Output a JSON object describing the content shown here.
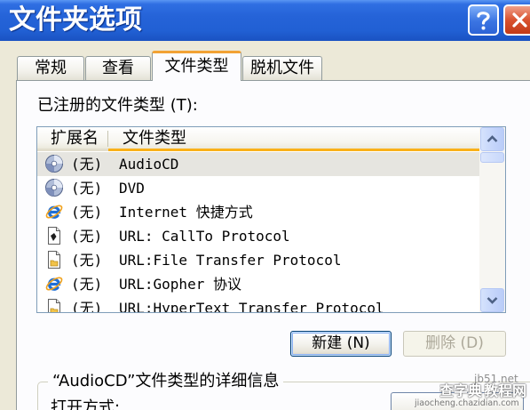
{
  "window": {
    "title": "文件夹选项",
    "help_icon": "help-icon",
    "close_icon": "close-icon"
  },
  "tabs": [
    {
      "label": "常规",
      "selected": false
    },
    {
      "label": "查看",
      "selected": false
    },
    {
      "label": "文件类型",
      "selected": true
    },
    {
      "label": "脱机文件",
      "selected": false
    }
  ],
  "file_types": {
    "label": "已注册的文件类型 (T):",
    "columns": [
      "扩展名",
      "文件类型"
    ],
    "rows": [
      {
        "extension": "(无)",
        "type": "AudioCD",
        "icon": "audio-cd-icon",
        "selected": true
      },
      {
        "extension": "(无)",
        "type": "DVD",
        "icon": "dvd-icon",
        "selected": false
      },
      {
        "extension": "(无)",
        "type": "Internet 快捷方式",
        "icon": "internet-shortcut-icon",
        "selected": false
      },
      {
        "extension": "(无)",
        "type": "URL: CallTo Protocol",
        "icon": "callto-protocol-icon",
        "selected": false
      },
      {
        "extension": "(无)",
        "type": "URL:File Transfer Protocol",
        "icon": "ftp-protocol-icon",
        "selected": false
      },
      {
        "extension": "(无)",
        "type": "URL:Gopher 协议",
        "icon": "gopher-protocol-icon",
        "selected": false
      },
      {
        "extension": "(无)",
        "type": "URL:HyperText Transfer Protocol",
        "icon": "http-protocol-icon",
        "selected": false
      }
    ],
    "scrollbar": {
      "up_icon": "chevron-up-icon",
      "down_icon": "chevron-down-icon"
    }
  },
  "actions": {
    "new_label": "新建 (N)",
    "delete_label": "删除 (D)",
    "delete_enabled": false
  },
  "details": {
    "title": "“AudioCD”文件类型的详细信息",
    "opens_with_label": "打开方式:"
  },
  "watermark": {
    "site": "jb51.net",
    "brand_left": "查字典",
    "brand_right": "教程网",
    "url": "jiaocheng.chazidian.com"
  },
  "colors": {
    "title_bar": "#2563D8",
    "dialog_background": "#ECE9D8",
    "selected_tab_accent": "#F2A234",
    "header_hover_accent": "#F9B119",
    "list_border": "#7F9DB9",
    "selected_row": "#E6E5E0",
    "disabled_text": "#ACA899"
  }
}
